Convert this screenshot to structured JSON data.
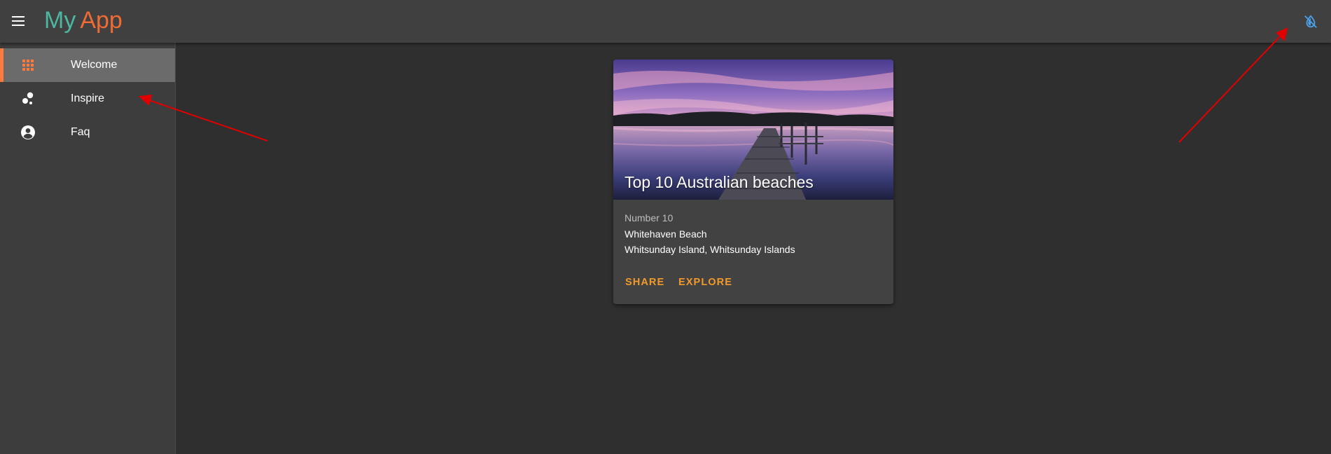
{
  "header": {
    "title_part1": "My",
    "title_part2": "App",
    "menu_icon": "menu-icon",
    "theme_icon": "invert-colors-icon"
  },
  "colors": {
    "title_part1": "#4db6a0",
    "title_part2": "#ee6b34",
    "accent": "#ff7a3d",
    "action": "#f19a2b",
    "theme_icon": "#4d9ee8",
    "annotation": "#e00000"
  },
  "sidebar": {
    "items": [
      {
        "label": "Welcome",
        "icon": "apps-grid-icon",
        "active": true
      },
      {
        "label": "Inspire",
        "icon": "bubble-chart-icon",
        "active": false
      },
      {
        "label": "Faq",
        "icon": "account-circle-icon",
        "active": false
      }
    ]
  },
  "card": {
    "title": "Top 10 Australian beaches",
    "subtitle": "Number 10",
    "line1": "Whitehaven Beach",
    "line2": "Whitsunday Island, Whitsunday Islands",
    "actions": [
      "SHARE",
      "EXPLORE"
    ]
  }
}
